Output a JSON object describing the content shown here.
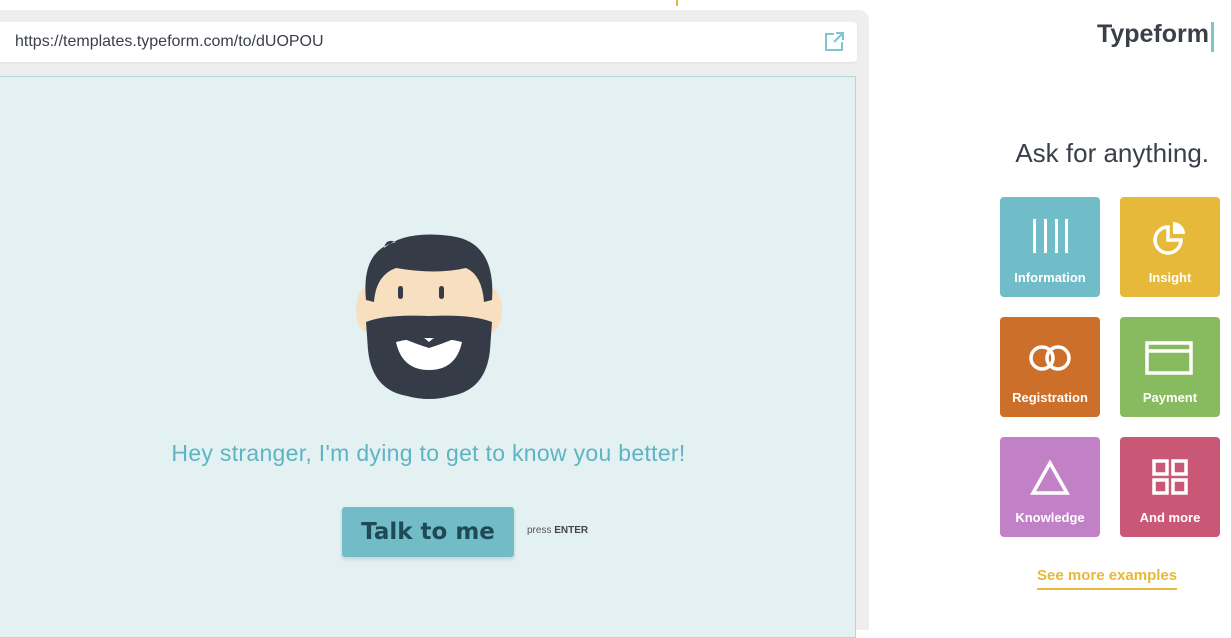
{
  "browser": {
    "url": "https://templates.typeform.com/to/dUOPOU"
  },
  "form": {
    "question": "Hey stranger, I'm dying to get to know you better!",
    "button_label": "Talk to me",
    "hint_prefix": "press",
    "hint_key": "ENTER"
  },
  "sidebar": {
    "brand": "Typeform",
    "headline": "Ask for anything.",
    "tiles": [
      {
        "label": "Information",
        "color": "#70bcc9",
        "icon": "bars-icon"
      },
      {
        "label": "Insight",
        "color": "#e6b93b",
        "icon": "pie-chart-icon"
      },
      {
        "label": "Registration",
        "color": "#cc6f2a",
        "icon": "rings-icon"
      },
      {
        "label": "Payment",
        "color": "#88bb5f",
        "icon": "card-icon"
      },
      {
        "label": "Knowledge",
        "color": "#c281c6",
        "icon": "triangle-icon"
      },
      {
        "label": "And more",
        "color": "#c95877",
        "icon": "grid-icon"
      }
    ],
    "see_more": "See more examples"
  }
}
